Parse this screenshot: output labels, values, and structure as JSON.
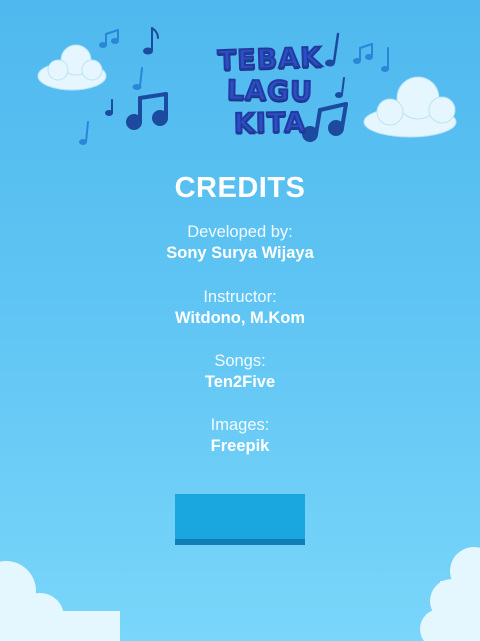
{
  "logo": {
    "line1": "TEBAK",
    "line2": "LAGU",
    "line3": "KITA"
  },
  "credits": {
    "heading": "CREDITS",
    "entries": [
      {
        "role": "Developed by:",
        "name": "Sony Surya Wijaya"
      },
      {
        "role": "Instructor:",
        "name": "Witdono, M.Kom"
      },
      {
        "role": "Songs:",
        "name": "Ten2Five"
      },
      {
        "role": "Images:",
        "name": "Freepik"
      }
    ]
  },
  "back_button": {
    "label": ""
  },
  "colors": {
    "background_top": "#4fb8ee",
    "background_bottom": "#7ad6fa",
    "logo_fill": "#2a4fc6",
    "text": "#ffffff",
    "button": "#1aa6de",
    "button_shadow": "#0f7fb4",
    "cloud": "#dff3fd"
  }
}
